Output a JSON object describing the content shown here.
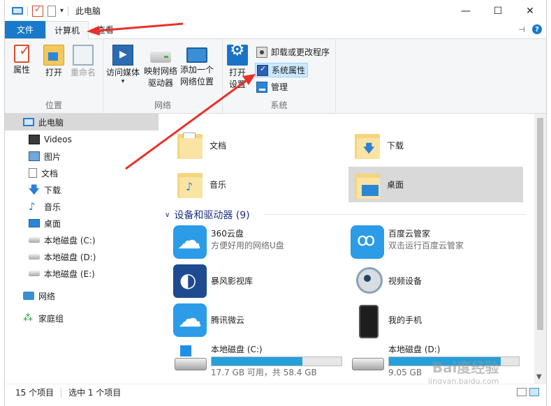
{
  "window": {
    "title": "此电脑",
    "buttons": {
      "minimize": "—",
      "maximize": "☐",
      "close": "✕"
    }
  },
  "tabs": {
    "file": "文件",
    "computer": "计算机",
    "view": "查看"
  },
  "ribbon": {
    "location": {
      "label": "位置",
      "properties": "属性",
      "open": "打开",
      "rename": "重命名"
    },
    "network": {
      "label": "网络",
      "access_media_1": "访问媒体",
      "map_drive_1": "映射网络",
      "map_drive_2": "驱动器",
      "add_location_1": "添加一个",
      "add_location_2": "网络位置"
    },
    "system": {
      "label": "系统",
      "open_settings_1": "打开",
      "open_settings_2": "设置",
      "uninstall": "卸载或更改程序",
      "system_properties": "系统属性",
      "manage": "管理"
    }
  },
  "nav": {
    "items": [
      {
        "label": "此电脑",
        "icon": "computer-icon"
      },
      {
        "label": "Videos",
        "icon": "video-icon"
      },
      {
        "label": "图片",
        "icon": "picture-icon"
      },
      {
        "label": "文档",
        "icon": "document-icon"
      },
      {
        "label": "下载",
        "icon": "download-icon"
      },
      {
        "label": "音乐",
        "icon": "music-icon"
      },
      {
        "label": "桌面",
        "icon": "desktop-icon"
      },
      {
        "label": "本地磁盘 (C:)",
        "icon": "drive-icon"
      },
      {
        "label": "本地磁盘 (D:)",
        "icon": "drive-icon"
      },
      {
        "label": "本地磁盘 (E:)",
        "icon": "drive-icon"
      },
      {
        "label": "网络",
        "icon": "network-icon"
      },
      {
        "label": "家庭组",
        "icon": "homegroup-icon"
      }
    ]
  },
  "folders": [
    {
      "name": "文档",
      "icon": "documents-folder-icon"
    },
    {
      "name": "下载",
      "icon": "downloads-folder-icon"
    },
    {
      "name": "音乐",
      "icon": "music-folder-icon"
    },
    {
      "name": "桌面",
      "icon": "desktop-folder-icon"
    }
  ],
  "devices_section": {
    "title": "设备和驱动器 (9)"
  },
  "devices": [
    {
      "name": "360云盘",
      "desc": "方便好用的网络U盘",
      "icon": "360-cloud-icon"
    },
    {
      "name": "百度云管家",
      "desc": "双击运行百度云管家",
      "icon": "baidu-cloud-icon"
    },
    {
      "name": "暴风影视库",
      "desc": "",
      "icon": "storm-video-icon"
    },
    {
      "name": "视频设备",
      "desc": "",
      "icon": "webcam-icon"
    },
    {
      "name": "腾讯微云",
      "desc": "",
      "icon": "weiyun-icon"
    },
    {
      "name": "我的手机",
      "desc": "",
      "icon": "phone-icon"
    },
    {
      "name": "本地磁盘 (C:)",
      "desc": "17.7 GB 可用，共 58.4 GB",
      "usage": 0.7,
      "icon": "local-disk-icon"
    },
    {
      "name": "本地磁盘 (D:)",
      "desc": "9.05 GB",
      "usage": 0.86,
      "icon": "local-disk-icon"
    }
  ],
  "status": {
    "count": "15 个项目",
    "selected": "选中 1 个项目"
  },
  "watermark": {
    "brand": "Bai度经验",
    "url": "jingyan.baidu.com"
  },
  "colors": {
    "accent": "#1979ca",
    "annotation_arrow": "#e8312a",
    "disk_bar": "#26a0da"
  }
}
